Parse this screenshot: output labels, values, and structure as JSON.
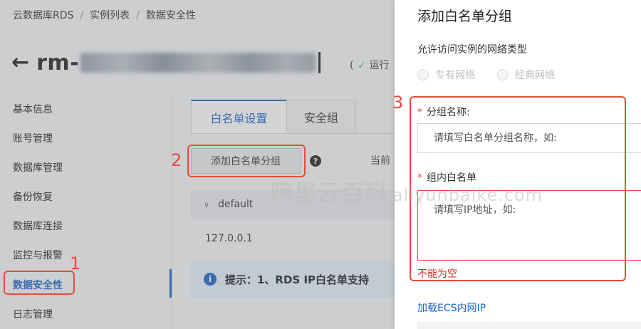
{
  "breadcrumb": {
    "items": [
      "云数据库RDS",
      "实例列表",
      "数据安全性"
    ]
  },
  "instance": {
    "id_prefix": "rm-",
    "status_label": "运行"
  },
  "sidebar": {
    "items": [
      {
        "label": "基本信息"
      },
      {
        "label": "账号管理"
      },
      {
        "label": "数据库管理"
      },
      {
        "label": "备份恢复"
      },
      {
        "label": "数据库连接"
      },
      {
        "label": "监控与报警"
      },
      {
        "label": "数据安全性",
        "active": true
      },
      {
        "label": "日志管理"
      }
    ]
  },
  "tabs": [
    {
      "label": "白名单设置",
      "active": true
    },
    {
      "label": "安全组"
    }
  ],
  "whitelist": {
    "add_button_label": "添加白名单分组",
    "help_glyph": "?",
    "current_label": "当前",
    "group_name": "default",
    "group_ip": "127.0.0.1",
    "tip_text": "提示：1、RDS IP白名单支持"
  },
  "drawer": {
    "title": "添加白名单分组",
    "network_label": "允许访问实例的网络类型",
    "network_options": [
      "专有网络",
      "经典网络"
    ],
    "group_name_label": "分组名称:",
    "group_name_placeholder": "请填写白名单分组名称，如:",
    "whitelist_label": "组内白名单",
    "whitelist_placeholder": "请填写IP地址，如:",
    "error_text": "不能为空",
    "load_ecs_link": "加载ECS内网IP"
  },
  "annotations": [
    "1",
    "2",
    "3"
  ],
  "watermark": {
    "cn": "阿里云百科",
    "en": "aliyunbaike.com"
  },
  "colors": {
    "accent": "#1a66c7",
    "annotation": "#e74c3c",
    "error": "#d93026"
  }
}
